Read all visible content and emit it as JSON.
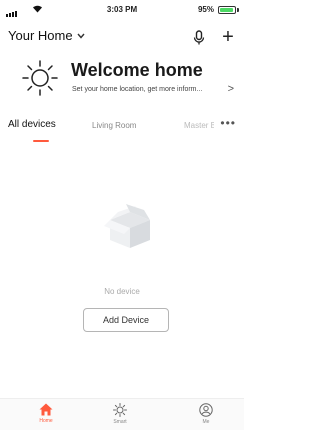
{
  "status_bar": {
    "time": "3:03 PM",
    "battery_percent": "95%",
    "battery_level": 0.95,
    "battery_color": "#4cd964",
    "icons": [
      "signal-icon",
      "wifi-icon",
      "battery-icon"
    ]
  },
  "header": {
    "home_name": "Your Home",
    "icons": [
      "chevron-down-icon",
      "microphone-icon",
      "plus-icon"
    ]
  },
  "welcome": {
    "title": "Welcome home",
    "subtitle": "Set your home location, get more inform...",
    "arrow": ">",
    "icon": "sun-icon"
  },
  "tabs": {
    "items": [
      {
        "label": "All devices",
        "active": true
      },
      {
        "label": "Living Room",
        "active": false
      },
      {
        "label": "Master B",
        "active": false
      }
    ],
    "more": "•••",
    "accent_color": "#ff5a3d"
  },
  "empty_state": {
    "icon": "empty-box-icon",
    "message": "No device",
    "button_label": "Add Device"
  },
  "bottom_nav": {
    "items": [
      {
        "label": "Home",
        "icon": "home-icon",
        "active": true
      },
      {
        "label": "Smart",
        "icon": "smart-sun-icon",
        "active": false
      },
      {
        "label": "Me",
        "icon": "profile-icon",
        "active": false
      }
    ]
  }
}
